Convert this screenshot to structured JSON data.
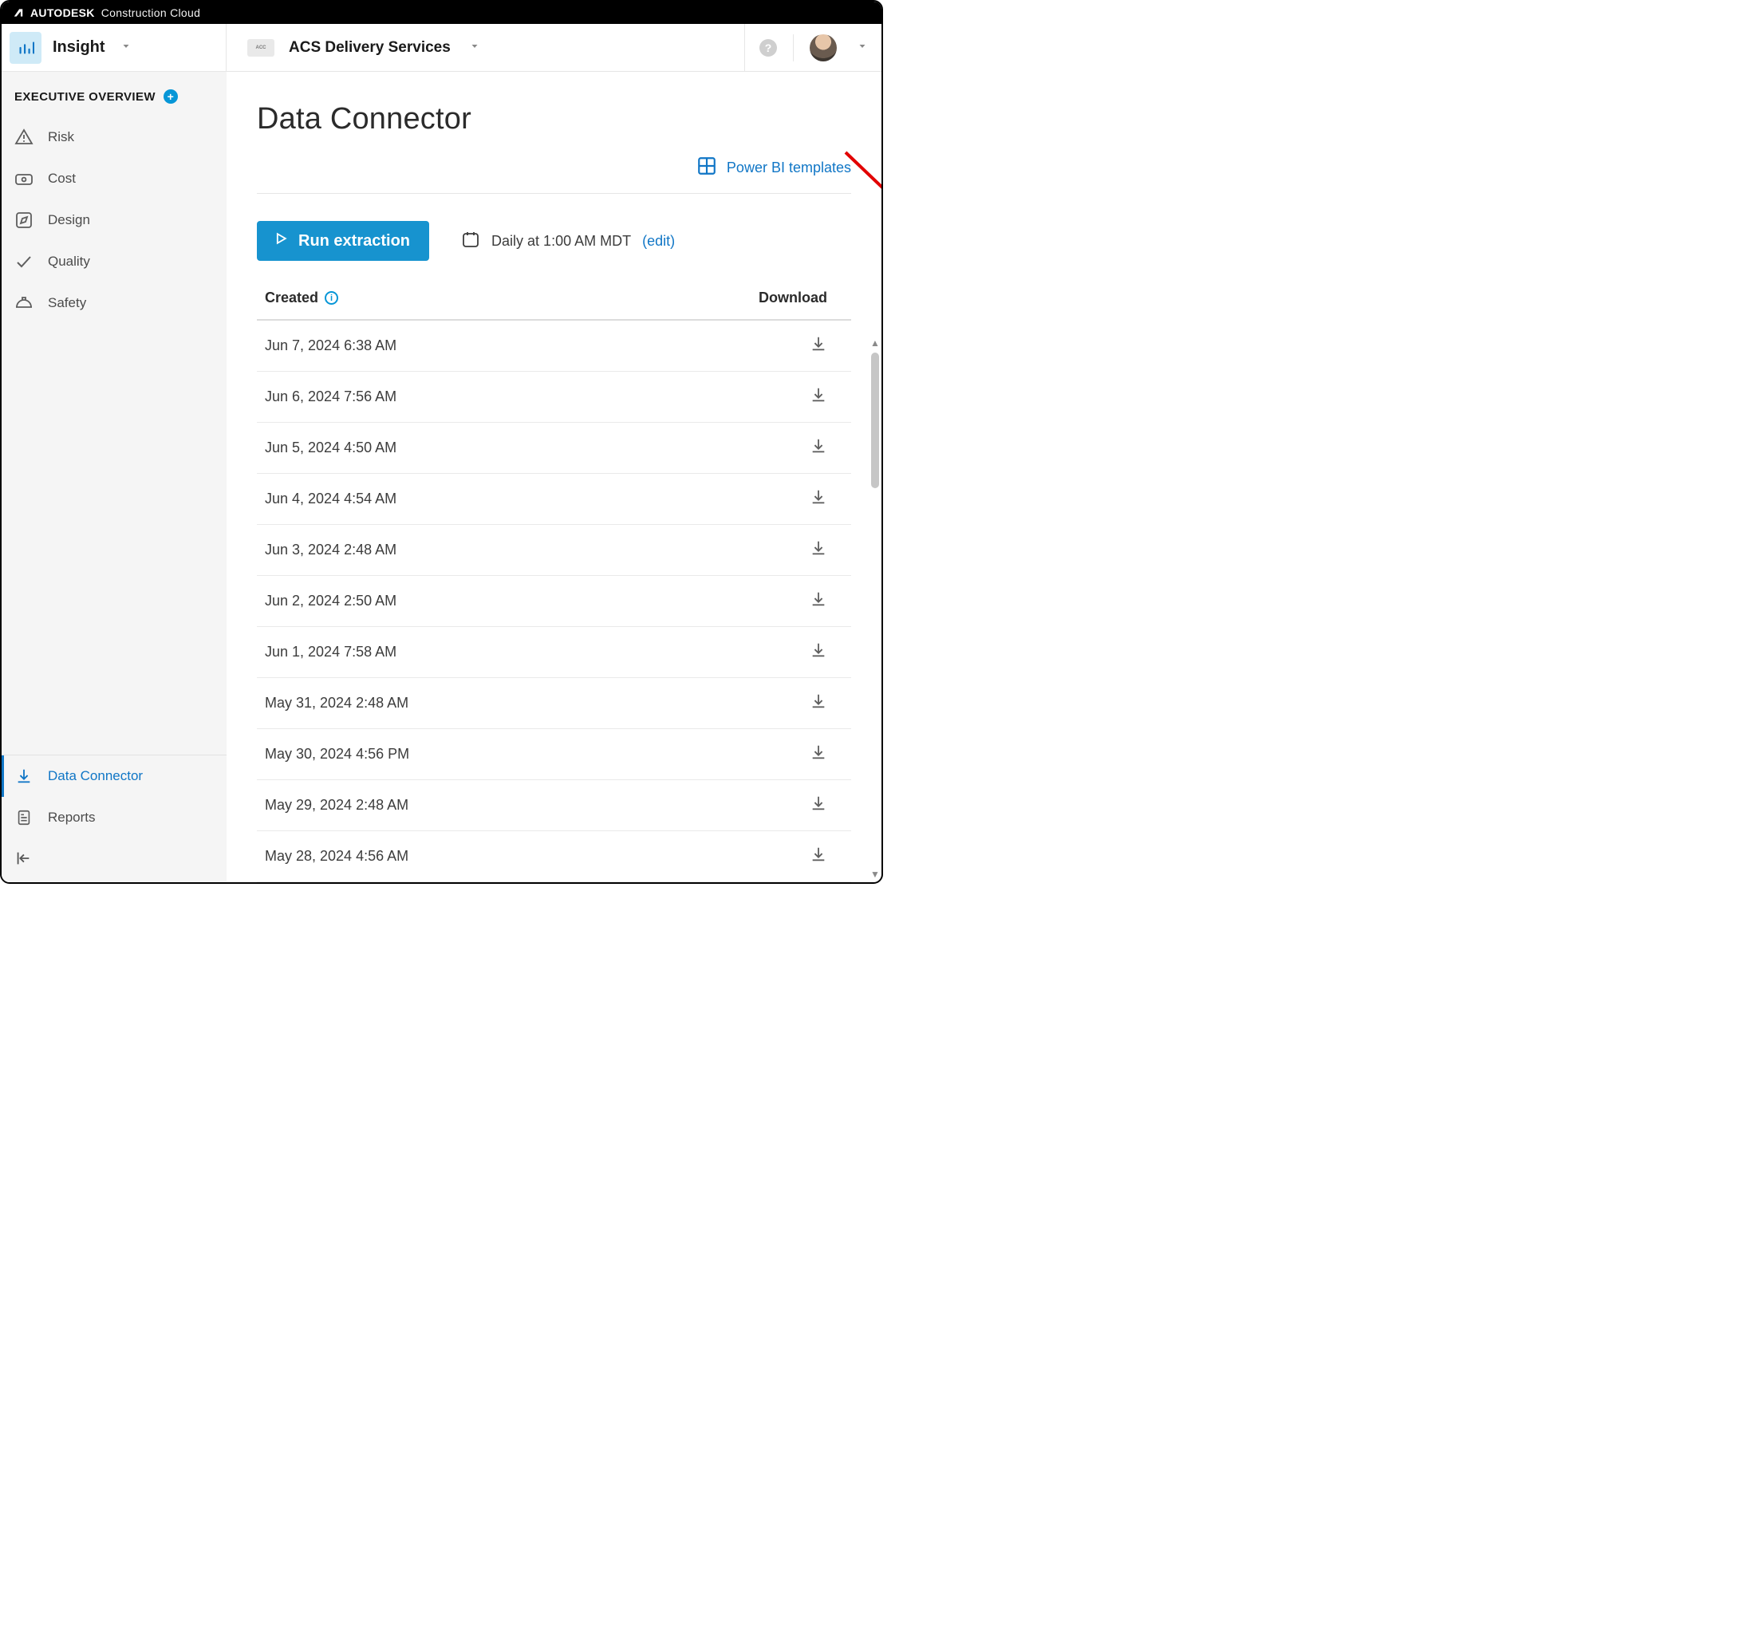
{
  "brand": {
    "strong": "AUTODESK",
    "light": "Construction Cloud"
  },
  "header": {
    "module": "Insight",
    "project": "ACS Delivery Services"
  },
  "sidebar": {
    "section_title": "EXECUTIVE OVERVIEW",
    "items": [
      {
        "label": "Risk",
        "icon": "warning-triangle-icon"
      },
      {
        "label": "Cost",
        "icon": "cash-icon"
      },
      {
        "label": "Design",
        "icon": "pencil-square-icon"
      },
      {
        "label": "Quality",
        "icon": "check-icon"
      },
      {
        "label": "Safety",
        "icon": "hardhat-icon"
      }
    ],
    "bottom": [
      {
        "label": "Data Connector",
        "icon": "download-icon",
        "active": true
      },
      {
        "label": "Reports",
        "icon": "report-icon",
        "active": false
      }
    ]
  },
  "main": {
    "title": "Data Connector",
    "powerbi_link": "Power BI templates",
    "run_button": "Run extraction",
    "schedule_text": "Daily at 1:00 AM MDT",
    "schedule_edit": "(edit)",
    "columns": {
      "created": "Created",
      "download": "Download"
    },
    "rows": [
      {
        "created": "Jun 7, 2024 6:38 AM"
      },
      {
        "created": "Jun 6, 2024 7:56 AM"
      },
      {
        "created": "Jun 5, 2024 4:50 AM"
      },
      {
        "created": "Jun 4, 2024 4:54 AM"
      },
      {
        "created": "Jun 3, 2024 2:48 AM"
      },
      {
        "created": "Jun 2, 2024 2:50 AM"
      },
      {
        "created": "Jun 1, 2024 7:58 AM"
      },
      {
        "created": "May 31, 2024 2:48 AM"
      },
      {
        "created": "May 30, 2024 4:56 PM"
      },
      {
        "created": "May 29, 2024 2:48 AM"
      },
      {
        "created": "May 28, 2024 4:56 AM"
      }
    ]
  }
}
